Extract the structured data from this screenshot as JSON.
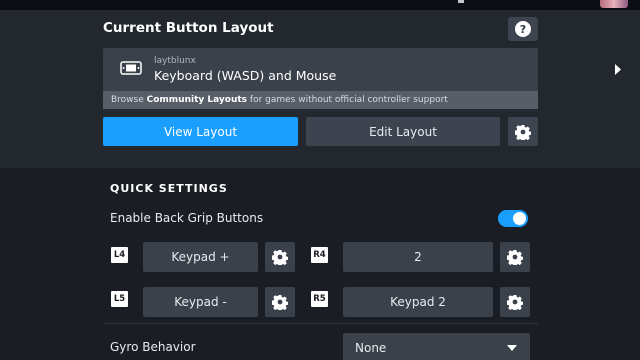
{
  "header": {
    "title": "Current Button Layout",
    "help_icon": "question-circle-icon"
  },
  "layout": {
    "author": "laytblunx",
    "name": "Keyboard (WASD) and Mouse",
    "icon": "controller-icon",
    "arrow_icon": "chevron-right-icon"
  },
  "community": {
    "prefix": "Browse ",
    "link": "Community Layouts",
    "suffix": " for games without official controller support"
  },
  "actions": {
    "view_label": "View Layout",
    "edit_label": "Edit Layout",
    "settings_icon": "gear-icon"
  },
  "quick_settings": {
    "title": "QUICK SETTINGS",
    "back_grip_label": "Enable Back Grip Buttons",
    "back_grip_enabled": true,
    "buttons": [
      {
        "badge": "L4",
        "value": "Keypad +"
      },
      {
        "badge": "R4",
        "value": "2"
      },
      {
        "badge": "L5",
        "value": "Keypad -"
      },
      {
        "badge": "R5",
        "value": "Keypad 2"
      }
    ],
    "gyro_label": "Gyro Behavior",
    "gyro_value": "None"
  },
  "colors": {
    "accent": "#1a9fff",
    "panel": "#3a414b",
    "background": "#1a1e24"
  }
}
